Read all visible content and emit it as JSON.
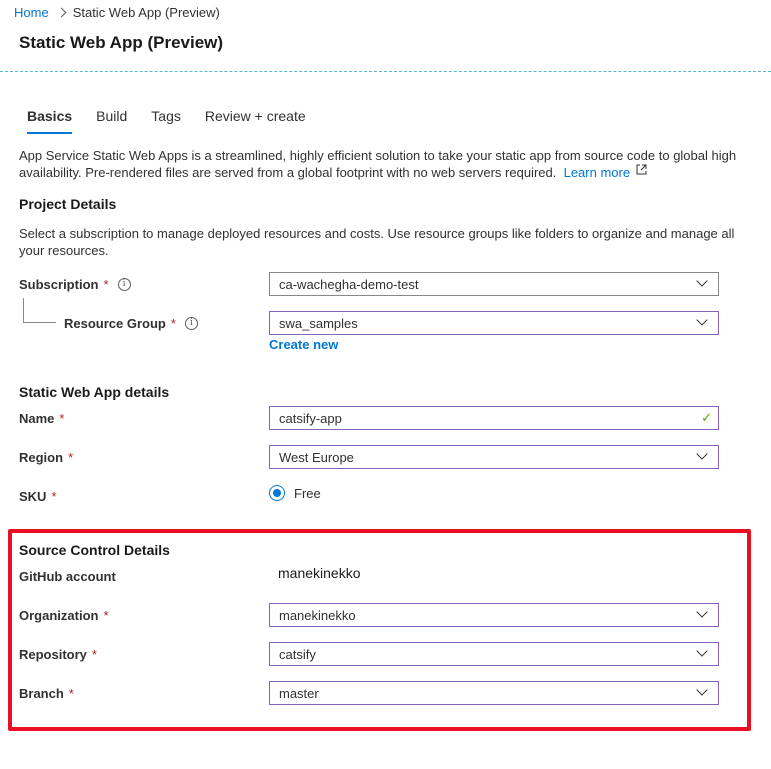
{
  "breadcrumb": {
    "home": "Home",
    "current": "Static Web App (Preview)"
  },
  "page": {
    "title": "Static Web App (Preview)"
  },
  "tabs": [
    {
      "label": "Basics",
      "active": true
    },
    {
      "label": "Build",
      "active": false
    },
    {
      "label": "Tags",
      "active": false
    },
    {
      "label": "Review + create",
      "active": false
    }
  ],
  "intro": {
    "text": "App Service Static Web Apps is a streamlined, highly efficient solution to take your static app from source code to global high availability. Pre-rendered files are served from a global footprint with no web servers required.",
    "learn_more": "Learn more"
  },
  "project": {
    "heading": "Project Details",
    "description": "Select a subscription to manage deployed resources and costs. Use resource groups like folders to organize and manage all your resources.",
    "subscription_label": "Subscription",
    "subscription_value": "ca-wachegha-demo-test",
    "resource_group_label": "Resource Group",
    "resource_group_value": "swa_samples",
    "create_new": "Create new"
  },
  "app_details": {
    "heading": "Static Web App details",
    "name_label": "Name",
    "name_value": "catsify-app",
    "region_label": "Region",
    "region_value": "West Europe",
    "sku_label": "SKU",
    "sku_option": "Free"
  },
  "source_control": {
    "heading": "Source Control Details",
    "github_label": "GitHub account",
    "github_value": "manekinekko",
    "org_label": "Organization",
    "org_value": "manekinekko",
    "repo_label": "Repository",
    "repo_value": "catsify",
    "branch_label": "Branch",
    "branch_value": "master"
  },
  "required_marker": "*",
  "colors": {
    "accent": "#0078d4",
    "highlight_box": "#e81123",
    "field_focus": "#8764b8",
    "valid_check": "#57a300"
  }
}
